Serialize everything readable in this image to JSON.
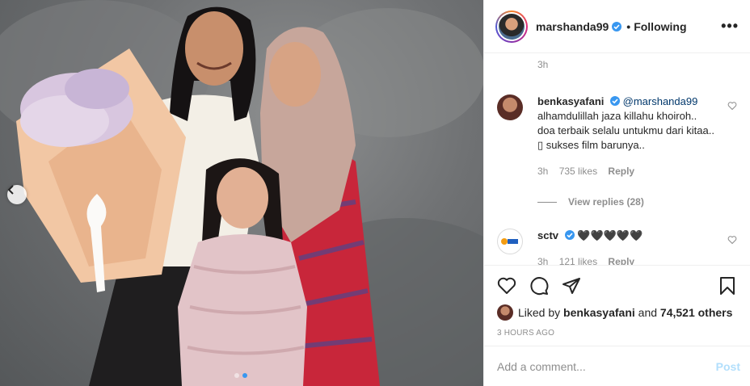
{
  "post": {
    "username": "marshanda99",
    "separator": "•",
    "follow_status": "Following",
    "more_label": "•••",
    "caption_time": "3h",
    "liked_by_prefix": "Liked by",
    "liked_by_user": "benkasyafani",
    "liked_by_mid": "and",
    "others_count": "74,521 others",
    "date": "3 HOURS AGO",
    "image_slide_count": 2,
    "image_active_slide": 1
  },
  "comments": [
    {
      "username": "benkasyafani",
      "mention": "@marshanda99",
      "text": "alhamdulillah jaza killahu khoiroh.. doa terbaik selalu untukmu dari kitaa.. ▯ sukses film barunya..",
      "time": "3h",
      "likes": "735 likes",
      "reply": "Reply",
      "view_replies": "View replies (28)"
    },
    {
      "username": "sctv",
      "text": "🖤🖤🖤🖤🖤",
      "time": "3h",
      "likes": "121 likes",
      "reply": "Reply"
    }
  ],
  "add_comment": {
    "placeholder": "Add a comment...",
    "post_label": "Post"
  },
  "icons": {
    "like": "heart-icon",
    "comment": "comment-icon",
    "share": "share-icon",
    "save": "bookmark-icon",
    "verified": "verified-badge-icon",
    "prev": "chevron-left-icon"
  },
  "colors": {
    "accent": "#3897f0",
    "post_disabled": "#b2dffc",
    "muted": "#8e8e8e",
    "mention": "#00376b"
  }
}
